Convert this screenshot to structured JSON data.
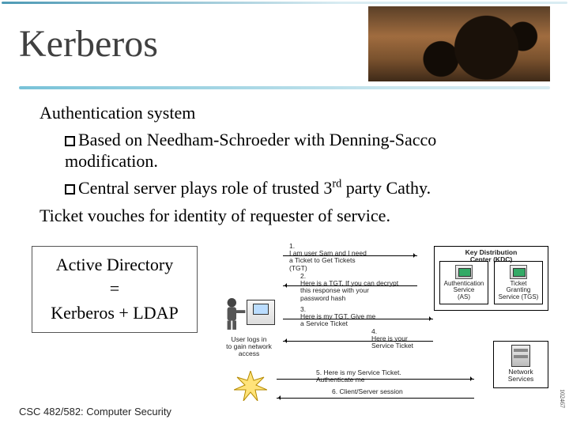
{
  "title": "Kerberos",
  "heading1": "Authentication system",
  "bullets": [
    "Based on Needham-Schroeder with Denning-Sacco modification.",
    "Central server plays role of trusted 3",
    " party Cathy."
  ],
  "super": "rd",
  "heading2": "Ticket vouches for identity of requester of service.",
  "ad_box": {
    "line1": "Active Directory",
    "line2": "=",
    "line3": "Kerberos + LDAP"
  },
  "diagram": {
    "kdc_title": "Key Distribution\nCenter (KDC)",
    "as": "Authentication\nService\n(AS)",
    "tgs": "Ticket\nGranting\nService (TGS)",
    "userlogin": "User logs in\nto gain network\naccess",
    "ns_title": "Network\nServices",
    "step1": "1.\nI am user Sam and I need\na Ticket to Get Tickets\n(TGT)",
    "step2": "2.\nHere is a TGT. If you can decrypt\nthis response with your\npassword hash",
    "step3": "3.\nHere is my TGT. Give me\na Service Ticket",
    "step4": "4.\nHere is your\nService Ticket",
    "step5": "5. Here is my Service Ticket.\nAuthenticate me",
    "step6": "6. Client/Server session"
  },
  "sidecode": "102467",
  "footer": "CSC 482/582: Computer Security"
}
